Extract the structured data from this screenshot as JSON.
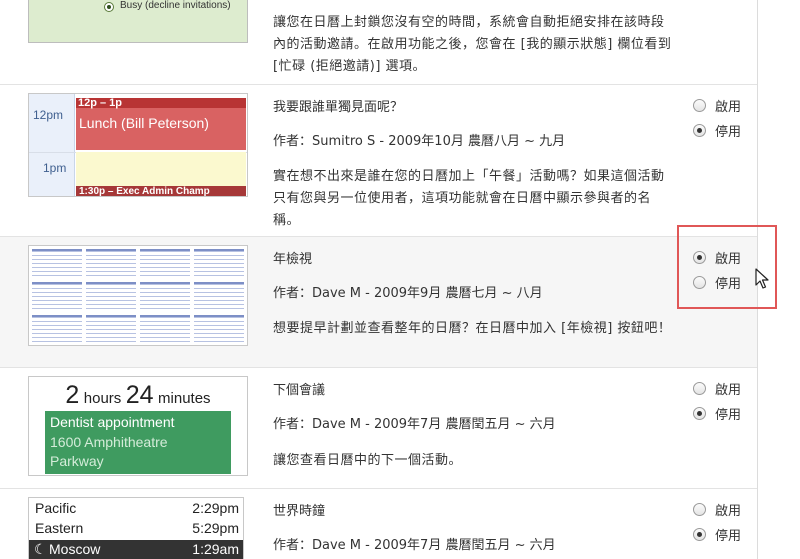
{
  "gadgets": [
    {
      "thumb": {
        "busy_label": "Busy (decline invitations)"
      },
      "description": "讓您在日曆上封鎖您沒有空的時間，系統會自動拒絕安排在該時段內的活動邀請。在啟用功能之後，您會在 [我的顯示狀態] 欄位看到 [忙碌 (拒絕邀請)] 選項。"
    },
    {
      "title": "我要跟誰單獨見面呢？",
      "author": "作者：Sumitro S - 2009年10月 農曆八月 ~ 九月",
      "description": "實在想不出來是誰在您的日曆加上「午餐」活動嗎？如果這個活動只有您與另一位使用者，這項功能就會在日曆中顯示參與者的名稱。",
      "thumb": {
        "time_12pm": "12pm",
        "time_1pm": "1pm",
        "event_time": "12p – 1p",
        "event_name": "Lunch (Bill Peterson)",
        "next_event": "1:30p – Exec Admin Champ"
      },
      "enable_label": "啟用",
      "disable_label": "停用",
      "selected": "disable"
    },
    {
      "title": "年檢視",
      "author": "作者：Dave M - 2009年9月 農曆七月 ~ 八月",
      "description": "想要提早計劃並查看整年的日曆？在日曆中加入 [年檢視] 按鈕吧！",
      "enable_label": "啟用",
      "disable_label": "停用",
      "selected": "enable"
    },
    {
      "title": "下個會議",
      "author": "作者：Dave M - 2009年7月 農曆閏五月 ~ 六月",
      "description": "讓您查看日曆中的下一個活動。",
      "thumb": {
        "hours": "2",
        "hours_unit": "hours",
        "minutes": "24",
        "minutes_unit": "minutes",
        "event_name": "Dentist appointment",
        "address_line1": "1600 Amphitheatre",
        "address_line2": "Parkway"
      },
      "enable_label": "啟用",
      "disable_label": "停用",
      "selected": "disable"
    },
    {
      "title": "世界時鐘",
      "author": "作者：Dave M - 2009年7月 農曆閏五月 ~ 六月",
      "thumb": {
        "clocks": [
          {
            "city": "Pacific",
            "time": "2:29pm"
          },
          {
            "city": "Eastern",
            "time": "5:29pm"
          },
          {
            "city": "Moscow",
            "time": "1:29am"
          }
        ]
      },
      "enable_label": "啟用",
      "disable_label": "停用",
      "selected": "disable"
    }
  ],
  "colors": {
    "highlight": "#e05757",
    "busy_green": "#ddeccf",
    "lunch_red": "#d96262",
    "dentist_green": "#3f9b60"
  }
}
